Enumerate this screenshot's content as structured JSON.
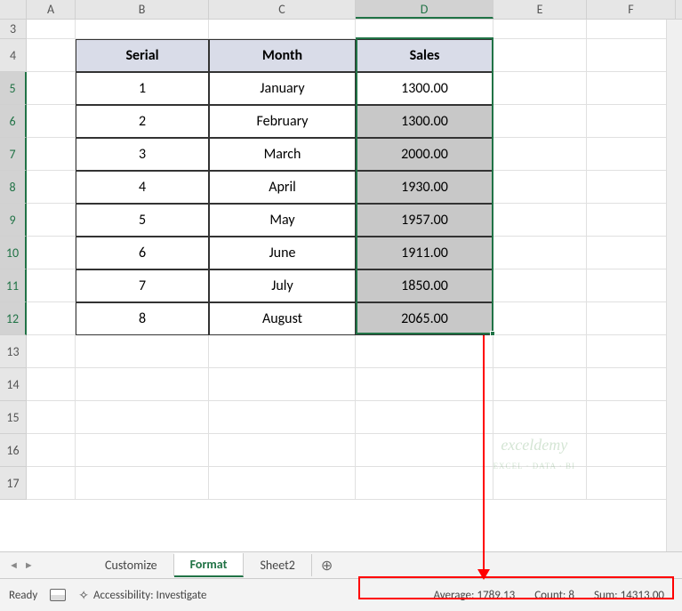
{
  "columns": [
    "A",
    "B",
    "C",
    "D",
    "E",
    "F"
  ],
  "rows_before": [
    "3"
  ],
  "header_row": "4",
  "data_rows": [
    "5",
    "6",
    "7",
    "8",
    "9",
    "10",
    "11",
    "12"
  ],
  "rows_after": [
    "13",
    "14",
    "15",
    "16",
    "17"
  ],
  "table": {
    "headers": {
      "serial": "Serial",
      "month": "Month",
      "sales": "Sales"
    },
    "data": [
      {
        "serial": "1",
        "month": "January",
        "sales": "1300.00"
      },
      {
        "serial": "2",
        "month": "February",
        "sales": "1300.00"
      },
      {
        "serial": "3",
        "month": "March",
        "sales": "2000.00"
      },
      {
        "serial": "4",
        "month": "April",
        "sales": "1930.00"
      },
      {
        "serial": "5",
        "month": "May",
        "sales": "1957.00"
      },
      {
        "serial": "6",
        "month": "June",
        "sales": "1911.00"
      },
      {
        "serial": "7",
        "month": "July",
        "sales": "1850.00"
      },
      {
        "serial": "8",
        "month": "August",
        "sales": "2065.00"
      }
    ]
  },
  "tabs": {
    "t1": "Customize",
    "t2": "Format",
    "t3": "Sheet2"
  },
  "status": {
    "ready": "Ready",
    "accessibility": "Accessibility: Investigate",
    "avg_label": "Average:",
    "avg_val": "1789.13",
    "count_label": "Count:",
    "count_val": "8",
    "sum_label": "Sum:",
    "sum_val": "14313.00"
  },
  "watermark": {
    "title": "exceldemy",
    "sub": "EXCEL · DATA · BI"
  },
  "add_sheet": "⊕"
}
